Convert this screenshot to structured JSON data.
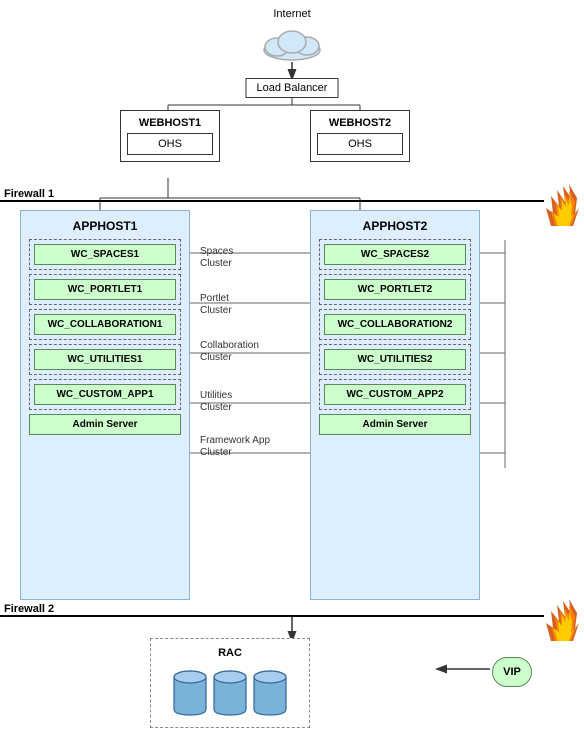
{
  "diagram": {
    "internet_label": "Internet",
    "load_balancer_label": "Load Balancer",
    "webhost1": {
      "label": "WEBHOST1",
      "ohs": "OHS"
    },
    "webhost2": {
      "label": "WEBHOST2",
      "ohs": "OHS"
    },
    "firewall1_label": "Firewall 1",
    "firewall2_label": "Firewall 2",
    "apphost1": {
      "label": "APPHOST1",
      "clusters": [
        {
          "wc": "WC_SPACES1",
          "cluster_label": "Spaces\nCluster"
        },
        {
          "wc": "WC_PORTLET1",
          "cluster_label": "Portlet\nCluster"
        },
        {
          "wc": "WC_COLLABORATION1",
          "cluster_label": "Collaboration\nCluster"
        },
        {
          "wc": "WC_UTILITIES1",
          "cluster_label": "Utilities\nCluster"
        },
        {
          "wc": "WC_CUSTOM_APP1",
          "cluster_label": "Framework App\nCluster"
        }
      ],
      "admin_server": "Admin Server"
    },
    "apphost2": {
      "label": "APPHOST2",
      "clusters": [
        {
          "wc": "WC_SPACES2"
        },
        {
          "wc": "WC_PORTLET2"
        },
        {
          "wc": "WC_COLLABORATION2"
        },
        {
          "wc": "WC_UTILITIES2"
        },
        {
          "wc": "WC_CUSTOM_APP2"
        }
      ],
      "admin_server": "Admin Server"
    },
    "rac_label": "RAC",
    "vip_label": "VIP"
  }
}
